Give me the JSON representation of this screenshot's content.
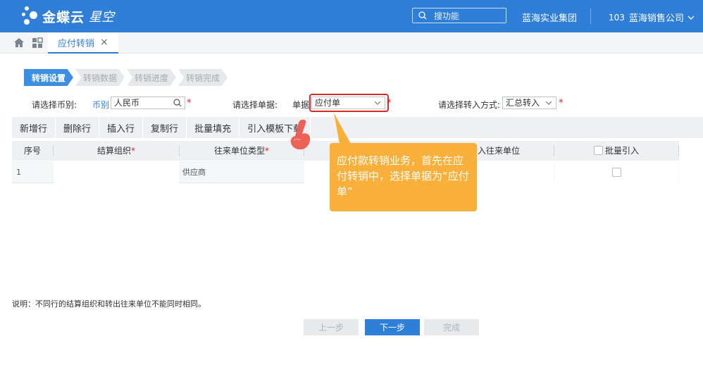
{
  "header": {
    "logo_text": "金蝶云",
    "logo_sub": "星空",
    "search_placeholder": "搜功能",
    "org_name": "蓝海实业集团",
    "account_id": "103",
    "account_name": "蓝海销售公司"
  },
  "tabs": [
    {
      "label": "应付转销"
    }
  ],
  "steps": [
    "转销设置",
    "转销数据",
    "转销进度",
    "转销完成"
  ],
  "form": {
    "currency_prompt": "请选择币别:",
    "currency_label": "币别",
    "currency_value": "人民币",
    "bill_prompt": "请选择单据:",
    "bill_label": "单据",
    "bill_value": "应付单",
    "mode_prompt": "请选择转入方式:",
    "mode_value": "汇总转入"
  },
  "toolbar": [
    "新增行",
    "删除行",
    "插入行",
    "复制行",
    "批量填充",
    "引入模板下载"
  ],
  "grid": {
    "columns": [
      "序号",
      "结算组织",
      "往来单位类型",
      "转入往来单位",
      "批量引入"
    ],
    "rows": [
      {
        "index": "1",
        "org": "",
        "unit_type": "供应商",
        "in_unit": ""
      }
    ]
  },
  "tooltip": "应付款转销业务，首先在应付转销中，选择单据为“应付单”",
  "note": "说明：不同行的结算组织和转出往来单位不能同时相同。",
  "footer": {
    "prev": "上一步",
    "next": "下一步",
    "finish": "完成"
  },
  "colors": {
    "brand": "#2f7fd9",
    "tooltip": "#f9b03a",
    "required": "#e02020"
  }
}
